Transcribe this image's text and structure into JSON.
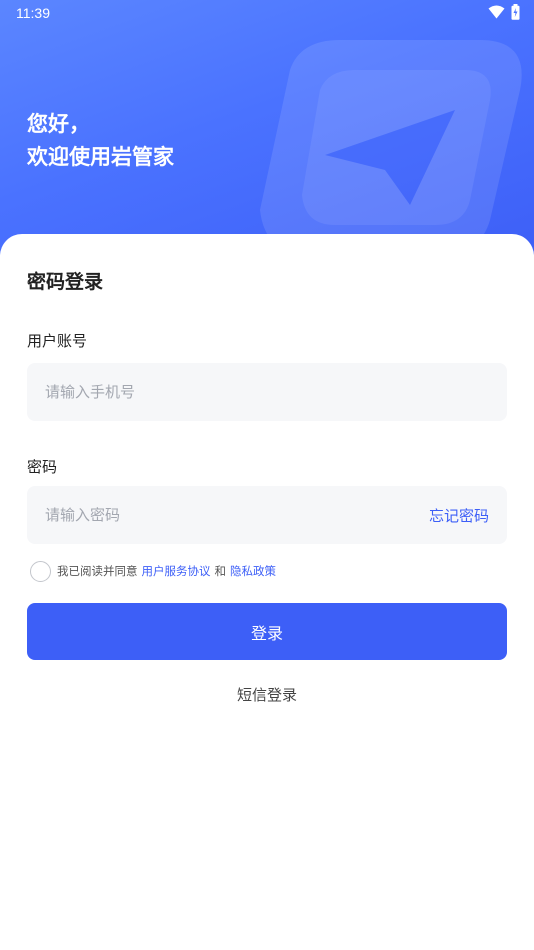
{
  "status_bar": {
    "time": "11:39"
  },
  "hero": {
    "greeting_line1": "您好，",
    "greeting_line2": "欢迎使用岩管家"
  },
  "form": {
    "title": "密码登录",
    "account_label": "用户账号",
    "account_placeholder": "请输入手机号",
    "account_value": "",
    "password_label": "密码",
    "password_placeholder": "请输入密码",
    "password_value": "",
    "forgot_label": "忘记密码"
  },
  "agreement": {
    "checked": false,
    "prefix": "我已阅读并同意",
    "terms_link": "用户服务协议",
    "and": "和",
    "privacy_link": "隐私政策"
  },
  "actions": {
    "login_label": "登录",
    "sms_login_label": "短信登录"
  },
  "colors": {
    "accent": "#3d5ff7",
    "hero_start": "#5b86ff",
    "hero_end": "#3d5ff7",
    "field_bg": "#f6f7f9"
  },
  "icons": {
    "wifi": "wifi-icon",
    "battery": "battery-icon",
    "logo": "app-logo-icon"
  }
}
